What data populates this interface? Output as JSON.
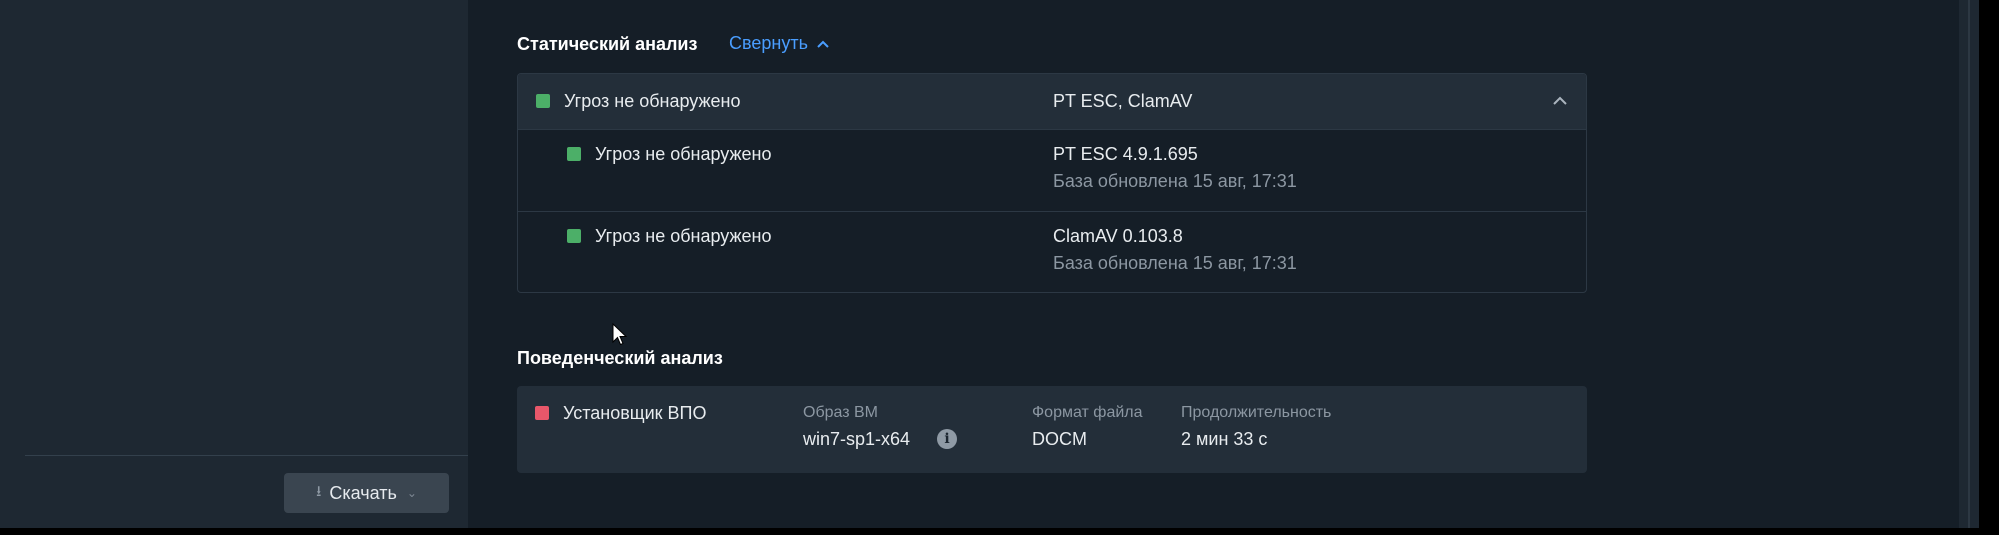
{
  "sidebar": {
    "download_button": {
      "label": "Скачать",
      "icon": "download-icon"
    }
  },
  "static_analysis": {
    "title": "Статический анализ",
    "collapse_label": "Свернуть",
    "summary": {
      "status": "Угроз не обнаружено",
      "engines": "PT ESC, ClamAV",
      "status_color": "#4caf68"
    },
    "engines": [
      {
        "status": "Угроз не обнаружено",
        "name": "PT ESC 4.9.1.695",
        "db_updated": "База обновлена 15 авг, 17:31",
        "status_color": "#4caf68"
      },
      {
        "status": "Угроз не обнаружено",
        "name": "ClamAV 0.103.8",
        "db_updated": "База обновлена 15 авг, 17:31",
        "status_color": "#4caf68"
      }
    ]
  },
  "behavioral_analysis": {
    "title": "Поведенческий анализ",
    "verdict": "Установщик ВПО",
    "verdict_color": "#e8576a",
    "vm_image": {
      "label": "Образ ВМ",
      "value": "win7-sp1-x64"
    },
    "file_format": {
      "label": "Формат файла",
      "value": "DOCM"
    },
    "duration": {
      "label": "Продолжительность",
      "value": "2 мин 33 с"
    }
  },
  "colors": {
    "accent": "#4a9eff",
    "background": "#151e27",
    "panel": "#232e39"
  }
}
